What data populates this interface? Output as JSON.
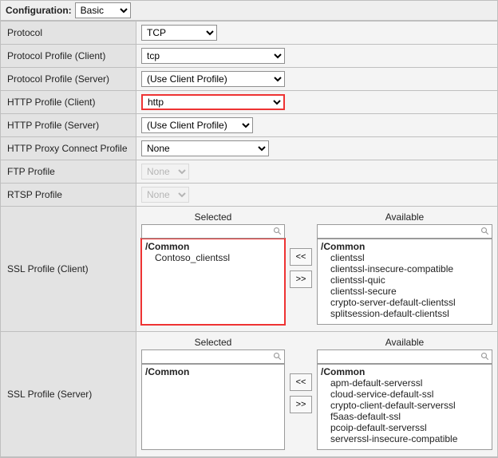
{
  "header": {
    "config_label": "Configuration:",
    "config_value": "Basic"
  },
  "rows": {
    "protocol": {
      "label": "Protocol",
      "value": "TCP"
    },
    "profile_client": {
      "label": "Protocol Profile (Client)",
      "value": "tcp"
    },
    "profile_server": {
      "label": "Protocol Profile (Server)",
      "value": "(Use Client Profile)"
    },
    "http_client": {
      "label": "HTTP Profile (Client)",
      "value": "http"
    },
    "http_server": {
      "label": "HTTP Profile (Server)",
      "value": "(Use Client Profile)"
    },
    "http_proxy": {
      "label": "HTTP Proxy Connect Profile",
      "value": "None"
    },
    "ftp": {
      "label": "FTP Profile",
      "value": "None"
    },
    "rtsp": {
      "label": "RTSP Profile",
      "value": "None"
    },
    "ssl_client": {
      "label": "SSL Profile (Client)"
    },
    "ssl_server": {
      "label": "SSL Profile (Server)"
    }
  },
  "dual": {
    "selected_hdr": "Selected",
    "available_hdr": "Available",
    "move_left": "<<",
    "move_right": ">>",
    "partition": "/Common"
  },
  "ssl_client": {
    "selected": [
      "Contoso_clientssl"
    ],
    "available": [
      "clientssl",
      "clientssl-insecure-compatible",
      "clientssl-quic",
      "clientssl-secure",
      "crypto-server-default-clientssl",
      "splitsession-default-clientssl"
    ]
  },
  "ssl_server": {
    "selected": [],
    "available": [
      "apm-default-serverssl",
      "cloud-service-default-ssl",
      "crypto-client-default-serverssl",
      "f5aas-default-ssl",
      "pcoip-default-serverssl",
      "serverssl-insecure-compatible"
    ]
  }
}
